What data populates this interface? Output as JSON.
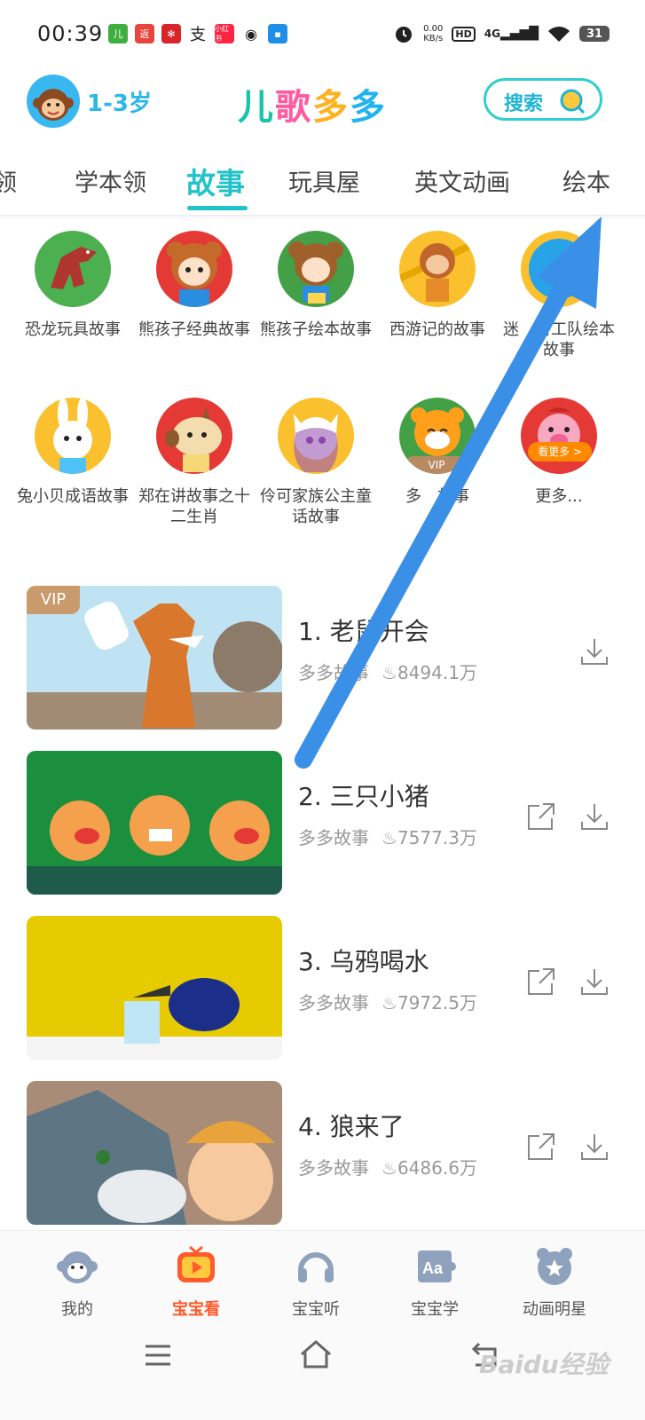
{
  "status_bar": {
    "time": "00:39",
    "net_speed_value": "0.00",
    "net_speed_unit": "KB/s",
    "hd": "HD",
    "network": "4G",
    "battery": "31"
  },
  "header": {
    "age_range": "1-3岁",
    "logo_chars": [
      "儿",
      "歌",
      "多",
      "多"
    ],
    "search_label": "搜索"
  },
  "tabs": [
    {
      "label": "领"
    },
    {
      "label": "学本领"
    },
    {
      "label": "故事"
    },
    {
      "label": "玩具屋"
    },
    {
      "label": "英文动画"
    },
    {
      "label": "绘本"
    }
  ],
  "categories": [
    {
      "label": "恐龙玩具故事"
    },
    {
      "label": "熊孩子经典故事"
    },
    {
      "label": "熊孩子绘本故事"
    },
    {
      "label": "西游记的故事"
    },
    {
      "label": "迷　特工队绘本故事"
    },
    {
      "label": "兔小贝成语故事"
    },
    {
      "label": "郑在讲故事之十二生肖"
    },
    {
      "label": "伶可家族公主童话故事"
    },
    {
      "label": "多　故事",
      "badge": "VIP"
    },
    {
      "label": "更多...",
      "badge": "看更多 >"
    }
  ],
  "stories": [
    {
      "title": "1. 老鼠开会",
      "source": "多多故事",
      "plays": "8494.1万",
      "vip": "VIP"
    },
    {
      "title": "2. 三只小猪",
      "source": "多多故事",
      "plays": "7577.3万"
    },
    {
      "title": "3. 乌鸦喝水",
      "source": "多多故事",
      "plays": "7972.5万"
    },
    {
      "title": "4. 狼来了",
      "source": "多多故事",
      "plays": "6486.6万"
    }
  ],
  "bottom_nav": [
    {
      "label": "我的"
    },
    {
      "label": "宝宝看"
    },
    {
      "label": "宝宝听"
    },
    {
      "label": "宝宝学"
    },
    {
      "label": "动画明星"
    }
  ],
  "watermark": "Baidu经验",
  "colors": {
    "accent": "#21c2c8",
    "active_nav": "#ff5a2c",
    "arrow": "#3a8fe6"
  }
}
